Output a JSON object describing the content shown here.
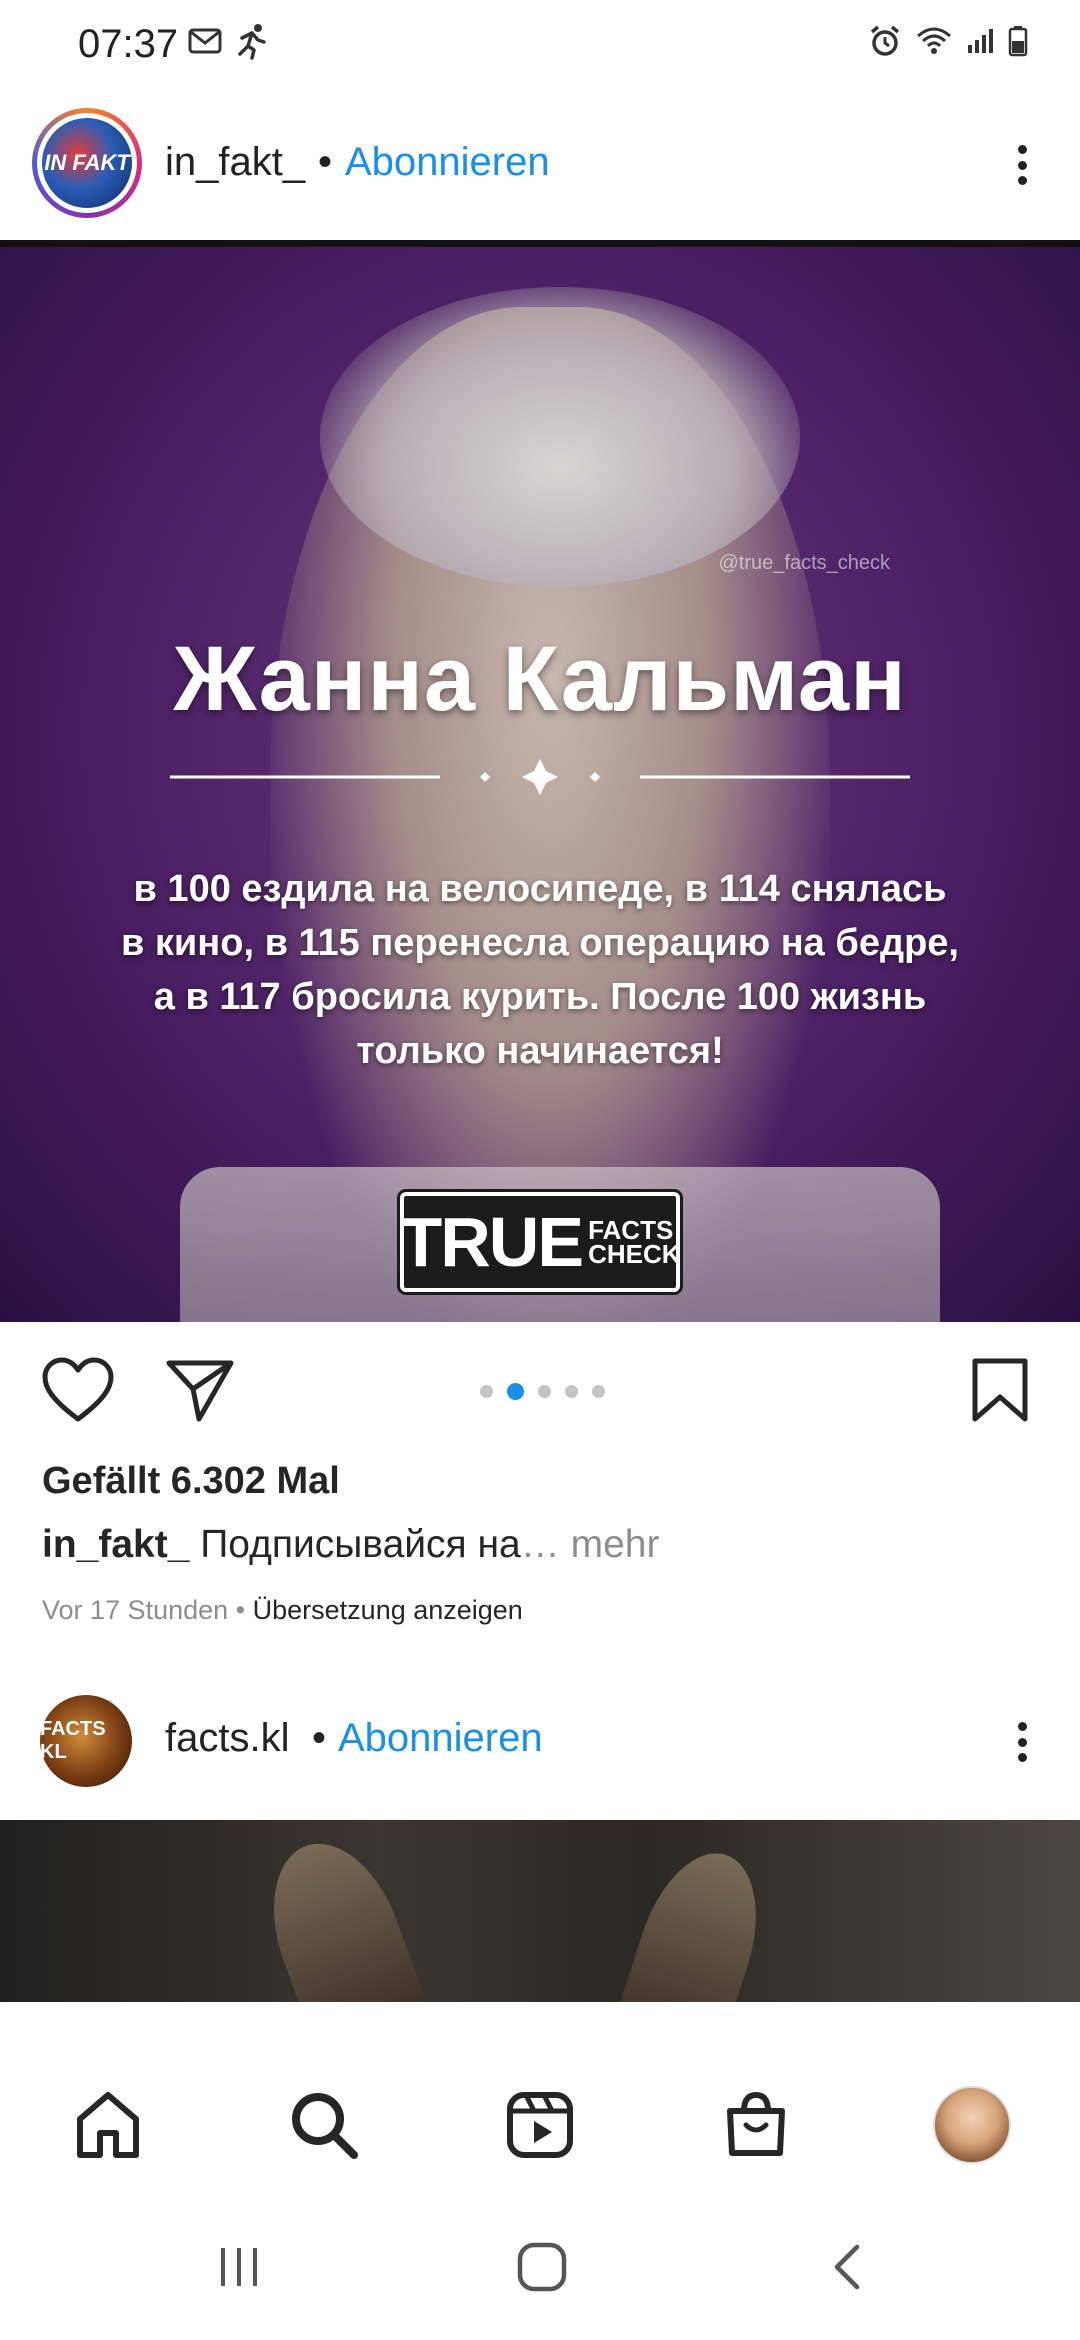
{
  "status_bar": {
    "time": "07:37"
  },
  "post1": {
    "username": "in_fakt_",
    "separator": "•",
    "follow_label": "Abonnieren",
    "avatar_text": "IN FAKT",
    "image": {
      "watermark": "@true_facts_check",
      "title": "Жанна Кальман",
      "body": "в 100 ездила на велосипеде, в 114 снялась в кино, в 115 перенесла операцию на бедре, а в 117 бросила курить. После 100 жизнь только начинается!",
      "badge_main": "TRUE",
      "badge_sub1": "FACTS",
      "badge_sub2": "CHECK"
    },
    "carousel": {
      "total": 5,
      "active_index": 1
    },
    "likes": "Gefällt 6.302 Mal",
    "caption_user": "in_fakt_",
    "caption_text": "Подписывайся на",
    "caption_more": "… mehr",
    "time_ago": "Vor 17 Stunden",
    "meta_separator": "•",
    "translate_label": "Übersetzung anzeigen"
  },
  "post2": {
    "username": "facts.kl",
    "separator": "•",
    "follow_label": "Abonnieren",
    "avatar_text": "FACTS KL"
  },
  "colors": {
    "accent": "#1a8fe8",
    "text": "#262626",
    "muted": "#8e8e8e"
  },
  "icons": {
    "nav": [
      "home-icon",
      "search-icon",
      "reels-icon",
      "shop-icon",
      "profile-avatar"
    ],
    "system": [
      "recents-icon",
      "home-button-icon",
      "back-icon"
    ]
  }
}
